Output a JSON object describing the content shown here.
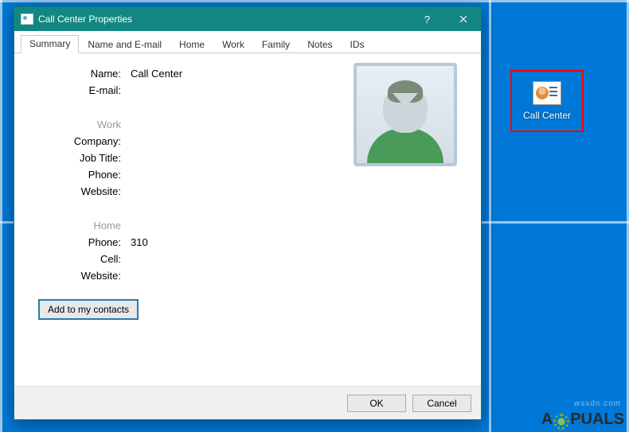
{
  "desktop": {
    "icon_label": "Call Center"
  },
  "dialog": {
    "title": "Call Center Properties",
    "tabs": [
      "Summary",
      "Name and E-mail",
      "Home",
      "Work",
      "Family",
      "Notes",
      "IDs"
    ],
    "active_tab": 0,
    "fields": {
      "name_label": "Name:",
      "name_value": "Call Center",
      "email_label": "E-mail:",
      "email_value": "",
      "work_section": "Work",
      "company_label": "Company:",
      "company_value": "",
      "jobtitle_label": "Job Title:",
      "jobtitle_value": "",
      "workphone_label": "Phone:",
      "workphone_value": "",
      "workwebsite_label": "Website:",
      "workwebsite_value": "",
      "home_section": "Home",
      "homephone_label": "Phone:",
      "homephone_value": "310",
      "cell_label": "Cell:",
      "cell_value": "",
      "homewebsite_label": "Website:",
      "homewebsite_value": ""
    },
    "add_button": "Add to my contacts",
    "ok": "OK",
    "cancel": "Cancel"
  },
  "watermark": {
    "pre": "A",
    "post": "PUALS",
    "site": "wsxdn.com"
  }
}
